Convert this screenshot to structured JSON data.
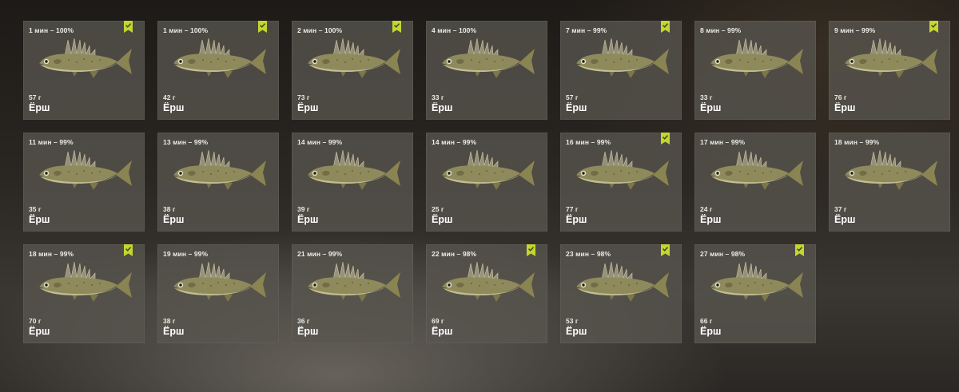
{
  "colors": {
    "bookmark": "#c3d631",
    "card_bg": "#58564f"
  },
  "icons": {
    "marked": "bookmark-check-icon",
    "fish": "ruffe-fish-icon"
  },
  "catches": [
    {
      "time": "1 мин – 100%",
      "weight": "57 г",
      "name": "Ёрш",
      "marked": true
    },
    {
      "time": "1 мин – 100%",
      "weight": "42 г",
      "name": "Ёрш",
      "marked": true
    },
    {
      "time": "2 мин – 100%",
      "weight": "73 г",
      "name": "Ёрш",
      "marked": true
    },
    {
      "time": "4 мин – 100%",
      "weight": "33 г",
      "name": "Ёрш",
      "marked": false
    },
    {
      "time": "7 мин – 99%",
      "weight": "57 г",
      "name": "Ёрш",
      "marked": true
    },
    {
      "time": "8 мин – 99%",
      "weight": "33 г",
      "name": "Ёрш",
      "marked": false
    },
    {
      "time": "9 мин – 99%",
      "weight": "76 г",
      "name": "Ёрш",
      "marked": true
    },
    {
      "time": "11 мин – 99%",
      "weight": "35 г",
      "name": "Ёрш",
      "marked": false
    },
    {
      "time": "13 мин – 99%",
      "weight": "38 г",
      "name": "Ёрш",
      "marked": false
    },
    {
      "time": "14 мин – 99%",
      "weight": "39 г",
      "name": "Ёрш",
      "marked": false
    },
    {
      "time": "14 мин – 99%",
      "weight": "25 г",
      "name": "Ёрш",
      "marked": false
    },
    {
      "time": "16 мин – 99%",
      "weight": "77 г",
      "name": "Ёрш",
      "marked": true
    },
    {
      "time": "17 мин – 99%",
      "weight": "24 г",
      "name": "Ёрш",
      "marked": false
    },
    {
      "time": "18 мин – 99%",
      "weight": "37 г",
      "name": "Ёрш",
      "marked": false
    },
    {
      "time": "18 мин – 99%",
      "weight": "70 г",
      "name": "Ёрш",
      "marked": true
    },
    {
      "time": "19 мин – 99%",
      "weight": "38 г",
      "name": "Ёрш",
      "marked": false
    },
    {
      "time": "21 мин – 99%",
      "weight": "36 г",
      "name": "Ёрш",
      "marked": false
    },
    {
      "time": "22 мин – 98%",
      "weight": "69 г",
      "name": "Ёрш",
      "marked": true
    },
    {
      "time": "23 мин – 98%",
      "weight": "53 г",
      "name": "Ёрш",
      "marked": true
    },
    {
      "time": "27 мин – 98%",
      "weight": "66 г",
      "name": "Ёрш",
      "marked": true
    }
  ]
}
